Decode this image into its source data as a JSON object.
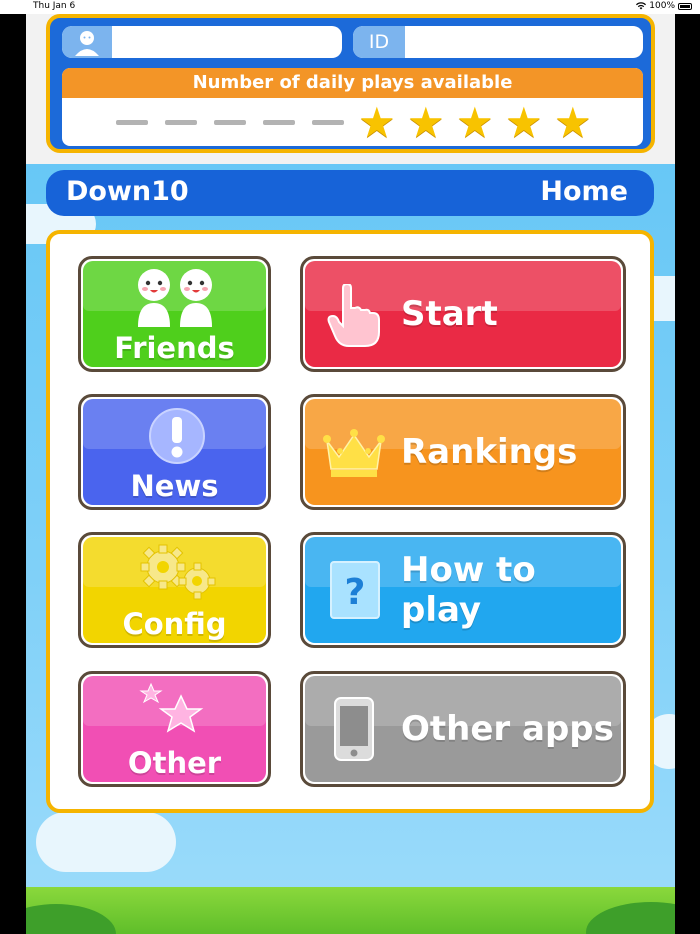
{
  "status_bar": {
    "date": "Thu Jan 6",
    "battery": "100%"
  },
  "profile": {
    "name_value": "",
    "id_label": "ID",
    "id_value": "",
    "plays_header": "Number of daily plays available",
    "plays_used": 5,
    "plays_total": 10
  },
  "title_bar": {
    "app_name": "Down10",
    "page": "Home"
  },
  "menu": {
    "friends": "Friends",
    "news": "News",
    "config": "Config",
    "other": "Other",
    "start": "Start",
    "rankings": "Rankings",
    "how_to_play": "How to play",
    "other_apps": "Other apps"
  },
  "colors": {
    "friends": "#4fcf1c",
    "news": "#4a64ee",
    "config": "#f2d500",
    "other": "#f14fb4",
    "start": "#ea2a45",
    "rankings": "#f7941e",
    "how_to_play": "#21a7ef",
    "other_apps": "#9a9a9a"
  },
  "icons": {
    "friends": "two-people-icon",
    "news": "exclamation-icon",
    "config": "gears-icon",
    "other": "stars-icon",
    "start": "pointing-hand-icon",
    "rankings": "crown-icon",
    "how_to_play": "question-card-icon",
    "other_apps": "smartphone-icon"
  }
}
